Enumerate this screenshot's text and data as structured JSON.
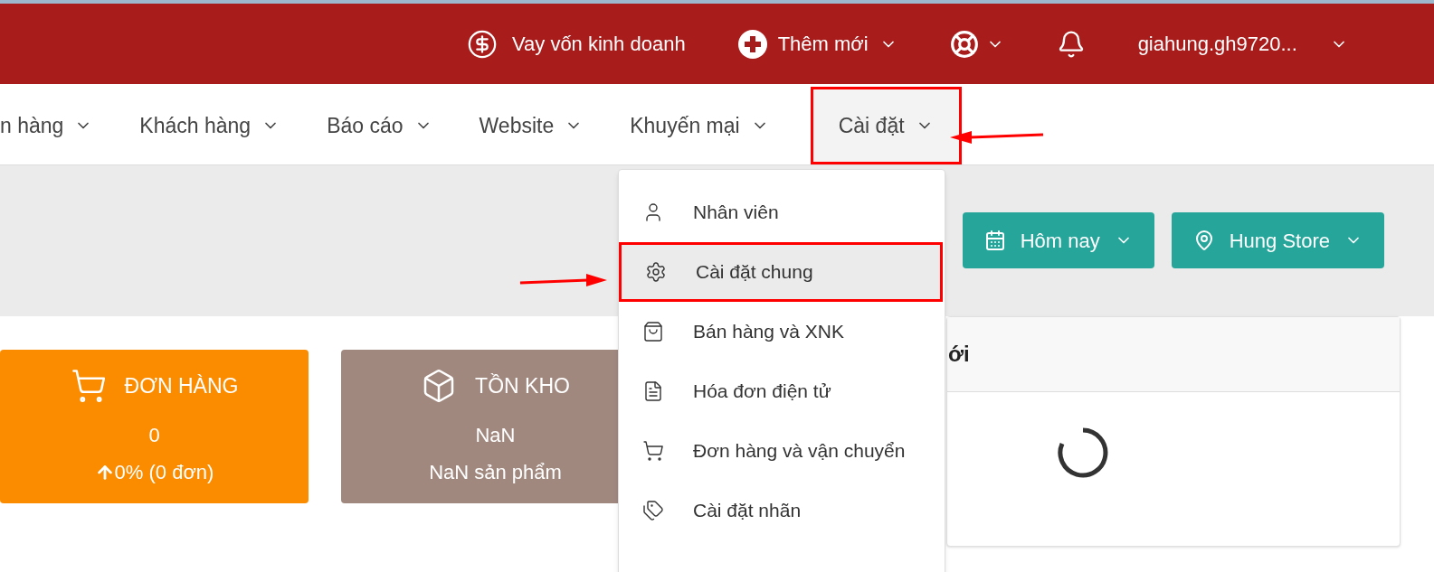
{
  "topbar": {
    "items": [
      {
        "kind": "loan",
        "label": "Vay vốn kinh doanh"
      },
      {
        "kind": "add",
        "label": "Thêm mới"
      },
      {
        "kind": "help"
      },
      {
        "kind": "bell"
      },
      {
        "kind": "user",
        "label": "giahung.gh9720..."
      }
    ]
  },
  "nav": {
    "items": [
      {
        "label": "n hàng",
        "selected": false,
        "highlighted": false
      },
      {
        "label": "Khách hàng",
        "selected": false,
        "highlighted": false
      },
      {
        "label": "Báo cáo",
        "selected": false,
        "highlighted": false
      },
      {
        "label": "Website",
        "selected": false,
        "highlighted": false
      },
      {
        "label": "Khuyến mại",
        "selected": false,
        "highlighted": false
      },
      {
        "label": "Cài đặt",
        "selected": true,
        "highlighted": true
      }
    ]
  },
  "filters": [
    {
      "kind": "date",
      "label": "Hôm nay"
    },
    {
      "kind": "store",
      "label": "Hung Store"
    }
  ],
  "stats": [
    {
      "kind": "orders",
      "color": "#fb8c00",
      "title": "ĐƠN HÀNG",
      "value": "0",
      "sub": "0% (0 đơn)"
    },
    {
      "kind": "stock",
      "color": "#a1887f",
      "title": "TỒN KHO",
      "value": "NaN",
      "sub": "NaN sản phẩm"
    }
  ],
  "panel": {
    "title": "ới",
    "loading": true
  },
  "menu": {
    "items": [
      {
        "kind": "user",
        "label": "Nhân viên",
        "selected": false,
        "highlighted": false
      },
      {
        "kind": "settings",
        "label": "Cài đặt chung",
        "selected": true,
        "highlighted": true
      },
      {
        "kind": "bag",
        "label": "Bán hàng và XNK",
        "selected": false,
        "highlighted": false
      },
      {
        "kind": "invoice",
        "label": "Hóa đơn điện tử",
        "selected": false,
        "highlighted": false
      },
      {
        "kind": "cart",
        "label": "Đơn hàng và vận chuyển",
        "selected": false,
        "highlighted": false
      },
      {
        "kind": "tags",
        "label": "Cài đặt nhãn",
        "selected": false,
        "highlighted": false
      }
    ]
  }
}
